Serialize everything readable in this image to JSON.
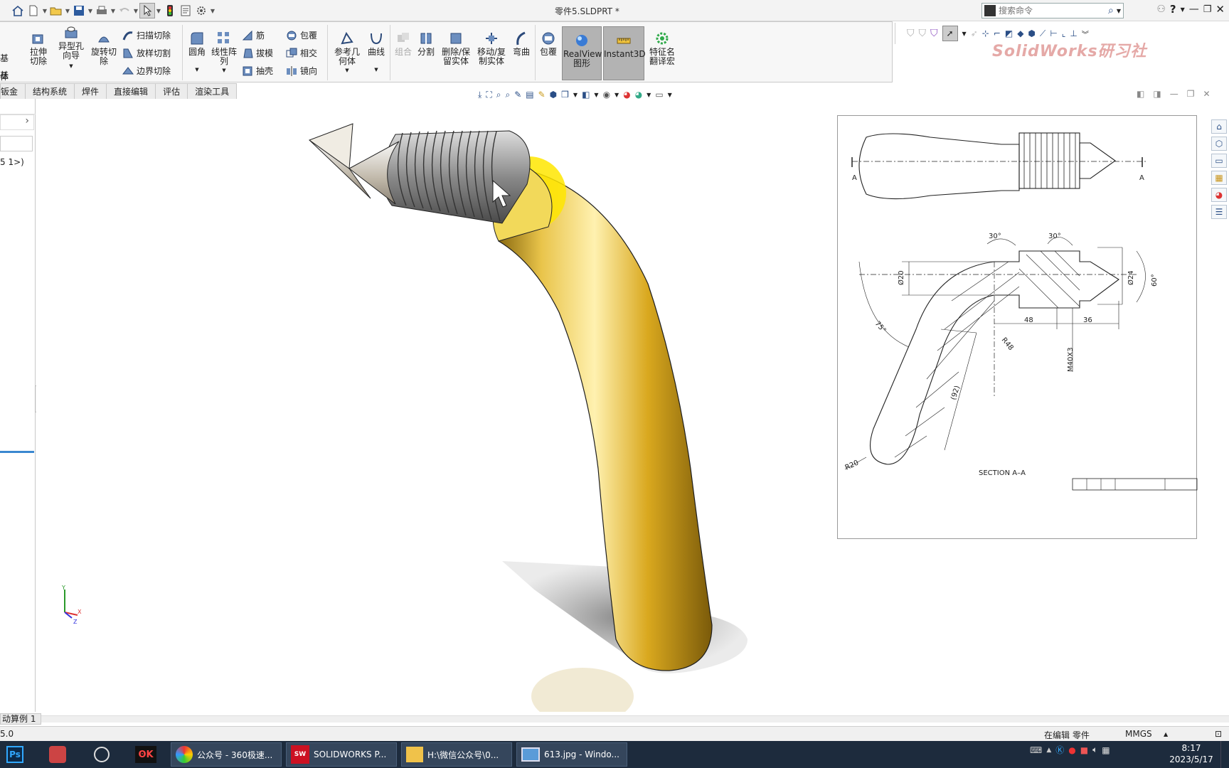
{
  "window": {
    "title": "零件5.SLDPRT *"
  },
  "search": {
    "placeholder": "搜索命令"
  },
  "ribbon": {
    "left_cut": [
      "基体",
      "基体"
    ],
    "buttons": {
      "extrude_cut": "拉伸切除",
      "hole_wizard": "异型孔向导",
      "revolve_cut": "旋转切除",
      "sweep_cut": "扫描切除",
      "loft_cut": "放样切割",
      "boundary_cut": "边界切除",
      "fillet": "圆角",
      "linear_pattern": "线性阵列",
      "rib": "筋",
      "draft": "拔模",
      "shell": "抽壳",
      "wrap": "包覆",
      "intersect": "相交",
      "mirror": "镜向",
      "ref_geometry": "参考几何体",
      "curves": "曲线",
      "combine": "组合",
      "split": "分割",
      "delete_keep_body": "删除/保留实体",
      "move_copy_body": "移动/复制实体",
      "flex": "弯曲",
      "wrap2": "包覆",
      "realview": "RealView图形",
      "instant3d": "Instant3D",
      "feature_translate": "特征名翻译宏"
    }
  },
  "watermark": "SolidWorks研习社",
  "tabs": [
    "钣金",
    "结构系统",
    "焊件",
    "直接编辑",
    "评估",
    "渲染工具"
  ],
  "left_panel": {
    "tree_item": "5 1>)"
  },
  "drawing": {
    "section_label": "SECTION A–A",
    "section_marks": [
      "A",
      "A"
    ],
    "dims": {
      "angle_top_left": "30°",
      "angle_top_right": "30°",
      "dia20": "Ø20",
      "dia24": "Ø24",
      "angle_tip": "60°",
      "angle_bend": "75°",
      "len48": "48",
      "len36": "36",
      "r48": "R48",
      "thread": "M40X3",
      "len92": "(92)",
      "r20": "R20"
    }
  },
  "model_tab": "动算例 1",
  "status": {
    "left": "5.0",
    "editing": "在编辑 零件",
    "units": "MMGS"
  },
  "taskbar": {
    "tasks": [
      {
        "label": "公众号 - 360极速..."
      },
      {
        "label": "SOLIDWORKS P..."
      },
      {
        "label": "H:\\微信公众号\\0..."
      },
      {
        "label": "613.jpg - Windo..."
      }
    ],
    "clock_time": "8:17",
    "clock_date": "2023/5/17"
  },
  "colors": {
    "gold": "#d9a81e",
    "thread_metal": "#a7a7a7",
    "highlight_yellow": "#ffe600",
    "taskbar": "#1d2b3d",
    "watermark": "#e5a9a7"
  }
}
